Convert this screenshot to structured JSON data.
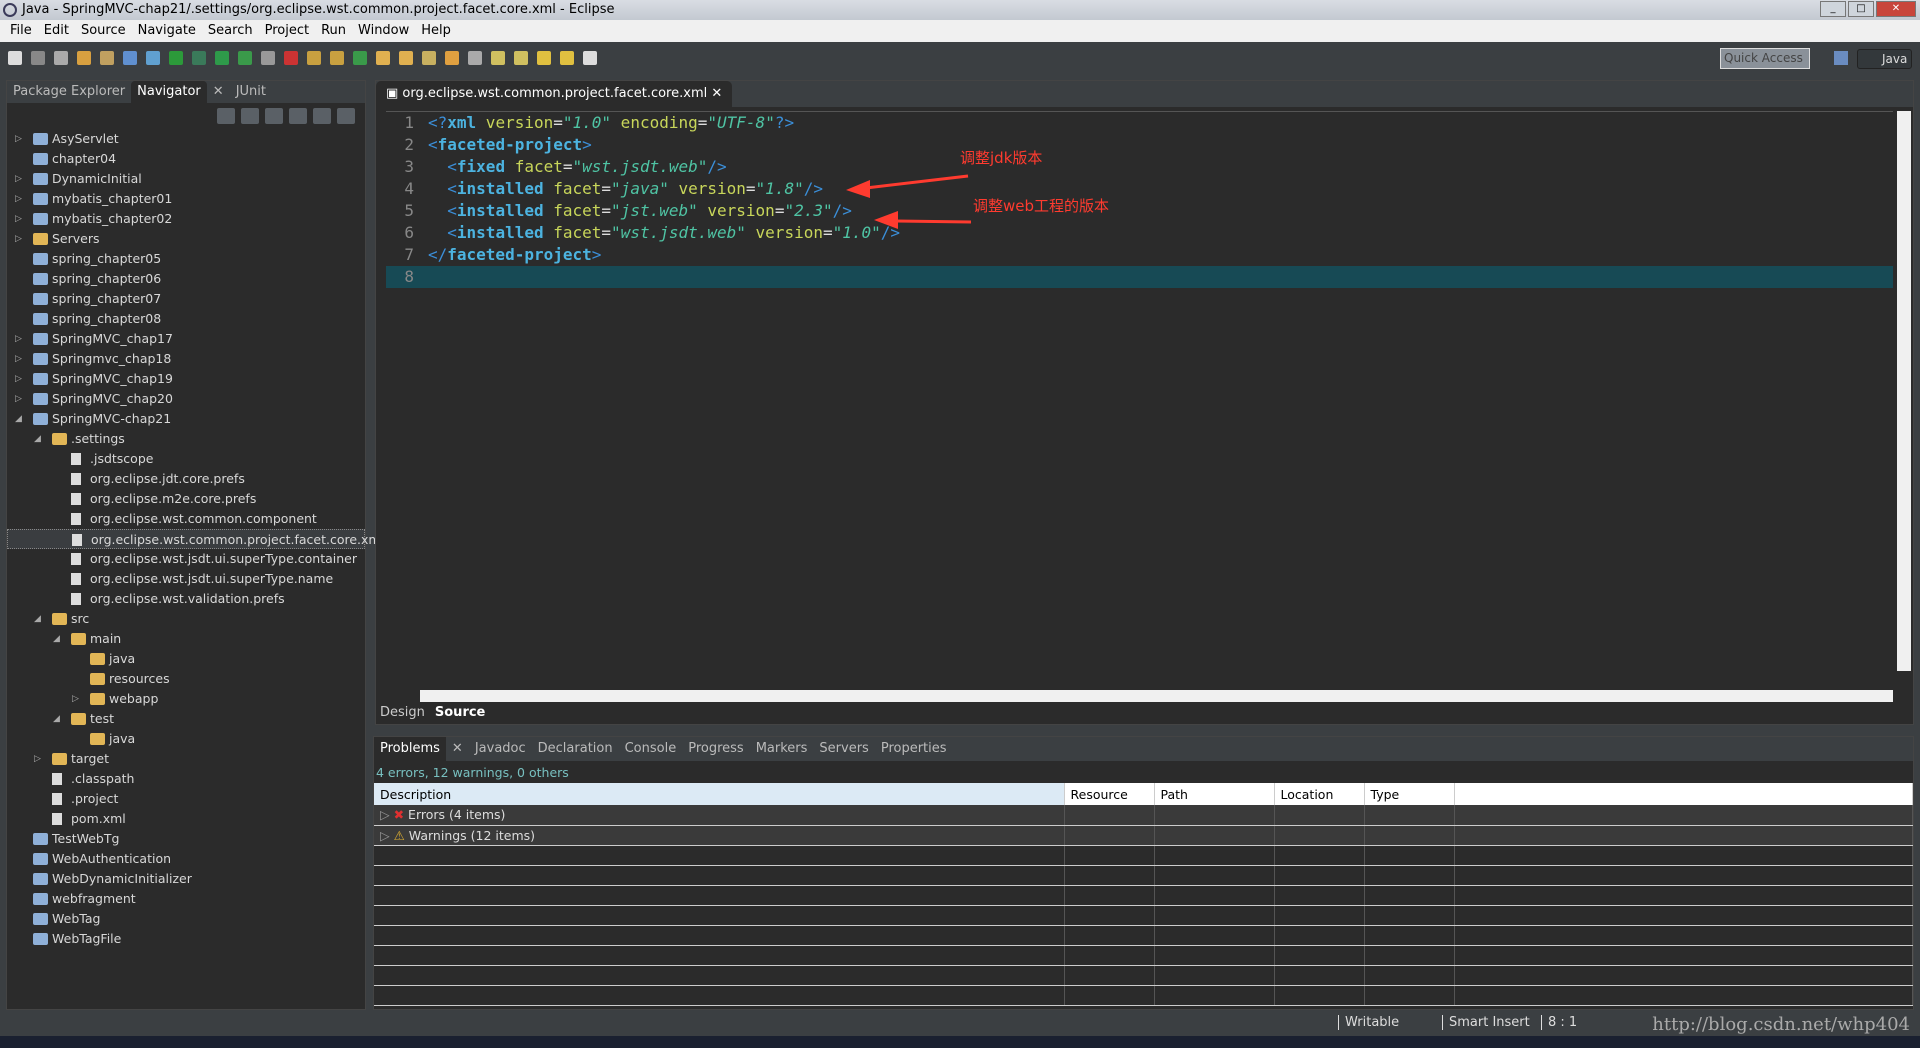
{
  "window": {
    "title": "Java - SpringMVC-chap21/.settings/org.eclipse.wst.common.project.facet.core.xml - Eclipse"
  },
  "menu": [
    "File",
    "Edit",
    "Source",
    "Navigate",
    "Search",
    "Project",
    "Run",
    "Window",
    "Help"
  ],
  "toolbar": {
    "quick_access_placeholder": "Quick Access",
    "perspective": "Java"
  },
  "left_panel": {
    "tabs": [
      {
        "label": "Package Explorer"
      },
      {
        "label": "Navigator",
        "active": true,
        "closable": true
      },
      {
        "label": "JUnit"
      }
    ],
    "tree": [
      {
        "label": "AsyServlet",
        "depth": 0,
        "state": "collapsed",
        "icon": "project-icon"
      },
      {
        "label": "chapter04",
        "depth": 0,
        "state": "leaf",
        "icon": "project-icon"
      },
      {
        "label": "DynamicInitial",
        "depth": 0,
        "state": "collapsed",
        "icon": "project-icon"
      },
      {
        "label": "mybatis_chapter01",
        "depth": 0,
        "state": "collapsed",
        "icon": "project-icon"
      },
      {
        "label": "mybatis_chapter02",
        "depth": 0,
        "state": "collapsed",
        "icon": "project-icon"
      },
      {
        "label": "Servers",
        "depth": 0,
        "state": "collapsed",
        "icon": "folder-icon"
      },
      {
        "label": "spring_chapter05",
        "depth": 0,
        "state": "leaf",
        "icon": "project-icon"
      },
      {
        "label": "spring_chapter06",
        "depth": 0,
        "state": "leaf",
        "icon": "project-icon"
      },
      {
        "label": "spring_chapter07",
        "depth": 0,
        "state": "leaf",
        "icon": "project-icon"
      },
      {
        "label": "spring_chapter08",
        "depth": 0,
        "state": "leaf",
        "icon": "project-icon"
      },
      {
        "label": "SpringMVC_chap17",
        "depth": 0,
        "state": "collapsed",
        "icon": "project-icon"
      },
      {
        "label": "Springmvc_chap18",
        "depth": 0,
        "state": "collapsed",
        "icon": "project-icon"
      },
      {
        "label": "SpringMVC_chap19",
        "depth": 0,
        "state": "collapsed",
        "icon": "project-icon"
      },
      {
        "label": "SpringMVC_chap20",
        "depth": 0,
        "state": "collapsed",
        "icon": "project-icon"
      },
      {
        "label": "SpringMVC-chap21",
        "depth": 0,
        "state": "expanded",
        "icon": "project-icon"
      },
      {
        "label": ".settings",
        "depth": 1,
        "state": "expanded",
        "icon": "folder-icon"
      },
      {
        "label": ".jsdtscope",
        "depth": 2,
        "state": "leaf",
        "icon": "file-icon"
      },
      {
        "label": "org.eclipse.jdt.core.prefs",
        "depth": 2,
        "state": "leaf",
        "icon": "file-icon"
      },
      {
        "label": "org.eclipse.m2e.core.prefs",
        "depth": 2,
        "state": "leaf",
        "icon": "file-icon"
      },
      {
        "label": "org.eclipse.wst.common.component",
        "depth": 2,
        "state": "leaf",
        "icon": "file-icon"
      },
      {
        "label": "org.eclipse.wst.common.project.facet.core.xml",
        "depth": 2,
        "state": "leaf",
        "icon": "file-icon",
        "selected": true
      },
      {
        "label": "org.eclipse.wst.jsdt.ui.superType.container",
        "depth": 2,
        "state": "leaf",
        "icon": "file-icon"
      },
      {
        "label": "org.eclipse.wst.jsdt.ui.superType.name",
        "depth": 2,
        "state": "leaf",
        "icon": "file-icon"
      },
      {
        "label": "org.eclipse.wst.validation.prefs",
        "depth": 2,
        "state": "leaf",
        "icon": "file-icon"
      },
      {
        "label": "src",
        "depth": 1,
        "state": "expanded",
        "icon": "folder-icon"
      },
      {
        "label": "main",
        "depth": 2,
        "state": "expanded",
        "icon": "folder-icon"
      },
      {
        "label": "java",
        "depth": 3,
        "state": "leaf",
        "icon": "folder-icon"
      },
      {
        "label": "resources",
        "depth": 3,
        "state": "leaf",
        "icon": "folder-icon"
      },
      {
        "label": "webapp",
        "depth": 3,
        "state": "collapsed",
        "icon": "folder-icon"
      },
      {
        "label": "test",
        "depth": 2,
        "state": "expanded",
        "icon": "folder-icon"
      },
      {
        "label": "java",
        "depth": 3,
        "state": "leaf",
        "icon": "folder-icon"
      },
      {
        "label": "target",
        "depth": 1,
        "state": "collapsed",
        "icon": "folder-icon"
      },
      {
        "label": ".classpath",
        "depth": 1,
        "state": "leaf",
        "icon": "file-icon"
      },
      {
        "label": ".project",
        "depth": 1,
        "state": "leaf",
        "icon": "file-icon"
      },
      {
        "label": "pom.xml",
        "depth": 1,
        "state": "leaf",
        "icon": "file-icon"
      },
      {
        "label": "TestWebTg",
        "depth": 0,
        "state": "leaf",
        "icon": "project-icon"
      },
      {
        "label": "WebAuthentication",
        "depth": 0,
        "state": "leaf",
        "icon": "project-icon"
      },
      {
        "label": "WebDynamicInitializer",
        "depth": 0,
        "state": "leaf",
        "icon": "project-icon"
      },
      {
        "label": "webfragment",
        "depth": 0,
        "state": "leaf",
        "icon": "project-icon"
      },
      {
        "label": "WebTag",
        "depth": 0,
        "state": "leaf",
        "icon": "project-icon"
      },
      {
        "label": "WebTagFile",
        "depth": 0,
        "state": "leaf",
        "icon": "project-icon"
      }
    ]
  },
  "editor": {
    "tab": "org.eclipse.wst.common.project.facet.core.xml",
    "lines": [
      [
        [
          "b",
          "<?"
        ],
        [
          "tag",
          "xml"
        ],
        [
          "attr",
          " version"
        ],
        [
          "eq",
          "="
        ],
        [
          "val",
          "\"1.0\""
        ],
        [
          "attr",
          " encoding"
        ],
        [
          "eq",
          "="
        ],
        [
          "val",
          "\"UTF-8\""
        ],
        [
          "b",
          "?>"
        ]
      ],
      [
        [
          "b",
          "<"
        ],
        [
          "tag",
          "faceted-project"
        ],
        [
          "b",
          ">"
        ]
      ],
      [
        [
          "b",
          "  <"
        ],
        [
          "tag",
          "fixed"
        ],
        [
          "attr",
          " facet"
        ],
        [
          "eq",
          "="
        ],
        [
          "val",
          "\"wst.jsdt.web\""
        ],
        [
          "b",
          "/>"
        ]
      ],
      [
        [
          "b",
          "  <"
        ],
        [
          "tag",
          "installed"
        ],
        [
          "attr",
          " facet"
        ],
        [
          "eq",
          "="
        ],
        [
          "val",
          "\"java\""
        ],
        [
          "attr",
          " version"
        ],
        [
          "eq",
          "="
        ],
        [
          "val",
          "\"1.8\""
        ],
        [
          "b",
          "/>"
        ]
      ],
      [
        [
          "b",
          "  <"
        ],
        [
          "tag",
          "installed"
        ],
        [
          "attr",
          " facet"
        ],
        [
          "eq",
          "="
        ],
        [
          "val",
          "\"jst.web\""
        ],
        [
          "attr",
          " version"
        ],
        [
          "eq",
          "="
        ],
        [
          "val",
          "\"2.3\""
        ],
        [
          "b",
          "/>"
        ]
      ],
      [
        [
          "b",
          "  <"
        ],
        [
          "tag",
          "installed"
        ],
        [
          "attr",
          " facet"
        ],
        [
          "eq",
          "="
        ],
        [
          "val",
          "\"wst.jsdt.web\""
        ],
        [
          "attr",
          " version"
        ],
        [
          "eq",
          "="
        ],
        [
          "val",
          "\"1.0\""
        ],
        [
          "b",
          "/>"
        ]
      ],
      [
        [
          "b",
          "</"
        ],
        [
          "tag",
          "faceted-project"
        ],
        [
          "b",
          ">"
        ]
      ],
      []
    ],
    "current_line": 8,
    "annotations": [
      "调整jdk版本",
      "调整web工程的版本"
    ],
    "bottom_tabs": [
      {
        "label": "Design"
      },
      {
        "label": "Source",
        "active": true
      }
    ]
  },
  "bottom_panel": {
    "tabs": [
      {
        "label": "Problems",
        "active": true
      },
      {
        "label": "Javadoc"
      },
      {
        "label": "Declaration"
      },
      {
        "label": "Console"
      },
      {
        "label": "Progress"
      },
      {
        "label": "Markers"
      },
      {
        "label": "Servers"
      },
      {
        "label": "Properties"
      }
    ],
    "summary": "4 errors, 12 warnings, 0 others",
    "columns": [
      "Description",
      "Resource",
      "Path",
      "Location",
      "Type"
    ],
    "rows": [
      {
        "label": "Errors (4 items)",
        "icon": "error-icon"
      },
      {
        "label": "Warnings (12 items)",
        "icon": "warning-icon"
      }
    ]
  },
  "status": {
    "writable": "Writable",
    "insert_mode": "Smart Insert",
    "position": "8 : 1"
  },
  "watermark": "http://blog.csdn.net/whp404",
  "colors": {
    "annotation": "#ff3b2f",
    "current_line": "#174a55",
    "tag": "#4cb3e0",
    "attribute": "#c8d65a",
    "value": "#4fc4a4"
  }
}
